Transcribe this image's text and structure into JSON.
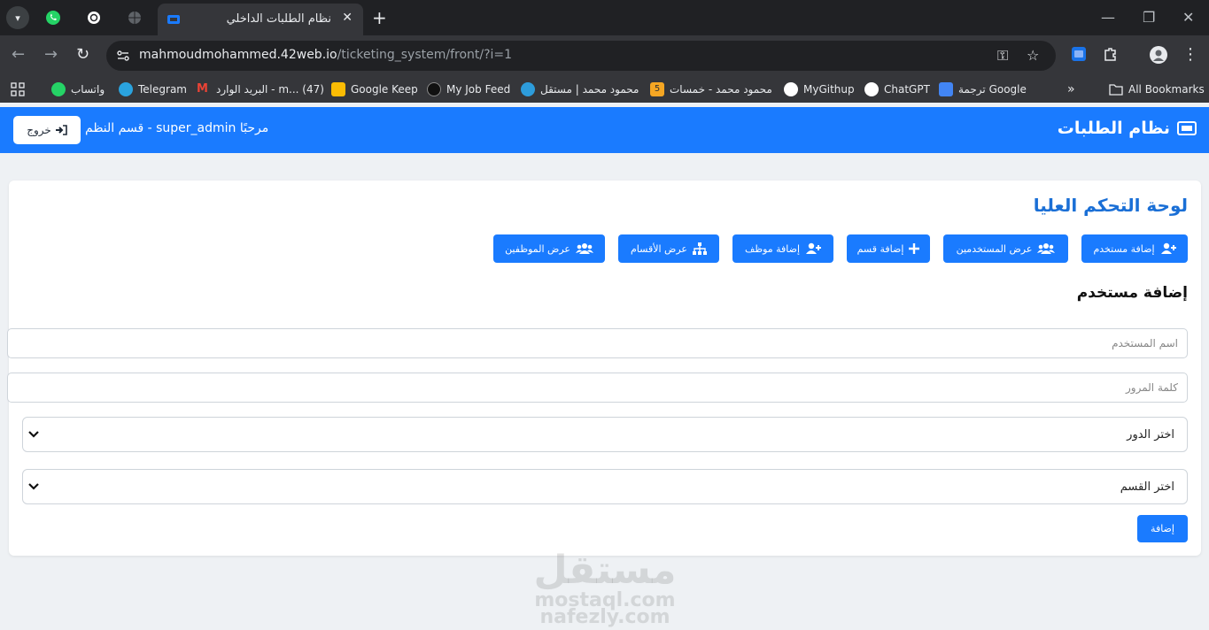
{
  "browser": {
    "active_tab_title": "نظام الطلبات الداخلي",
    "url_host": "mahmoudmohammed.42web.io",
    "url_path": "/ticketing_system/front/?i=1",
    "bookmarks": [
      {
        "label": "واتساب",
        "icon": "whatsapp-icon",
        "color": "#25d366"
      },
      {
        "label": "Telegram",
        "icon": "telegram-icon",
        "color": "#2aa3df"
      },
      {
        "label": "البريد الوارد - m... (47)",
        "icon": "gmail-icon",
        "color": "#ea4335"
      },
      {
        "label": "Google Keep",
        "icon": "keep-icon",
        "color": "#fbbc04"
      },
      {
        "label": "My Job Feed",
        "icon": "upwork-icon",
        "color": "#111111"
      },
      {
        "label": "محمود محمد | مستقل",
        "icon": "mostaql-icon",
        "color": "#2d9cdb"
      },
      {
        "label": "محمود محمد - خمسات",
        "icon": "khamsat-icon",
        "color": "#f5a623"
      },
      {
        "label": "MyGithup",
        "icon": "github-icon",
        "color": "#ffffff"
      },
      {
        "label": "ChatGPT",
        "icon": "chatgpt-icon",
        "color": "#ffffff"
      },
      {
        "label": "ترجمة Google",
        "icon": "translate-icon",
        "color": "#4285f4"
      }
    ],
    "all_bookmarks": "All Bookmarks"
  },
  "app": {
    "brand": "نظام الطلبات",
    "welcome": "مرحبًا super_admin - قسم النظم",
    "logout": "خروج",
    "accent": "#1a7bff"
  },
  "dashboard": {
    "title": "لوحة التحكم العليا",
    "actions": [
      {
        "label": "إضافة مستخدم",
        "icon": "user-plus-icon"
      },
      {
        "label": "عرض المستخدمين",
        "icon": "users-icon"
      },
      {
        "label": "إضافة قسم",
        "icon": "plus-icon"
      },
      {
        "label": "إضافة موظف",
        "icon": "user-plus-icon"
      },
      {
        "label": "عرض الأقسام",
        "icon": "sitemap-icon"
      },
      {
        "label": "عرض الموظفين",
        "icon": "users-icon"
      }
    ]
  },
  "form": {
    "title": "إضافة مستخدم",
    "username_placeholder": "اسم المستخدم",
    "password_placeholder": "كلمة المرور",
    "role_select": "اختر الدور",
    "department_select": "اختر القسم",
    "submit": "إضافة"
  },
  "watermark": {
    "arabic": "مستقل",
    "line1": "mostaql.com",
    "line2": "nafezly.com"
  }
}
